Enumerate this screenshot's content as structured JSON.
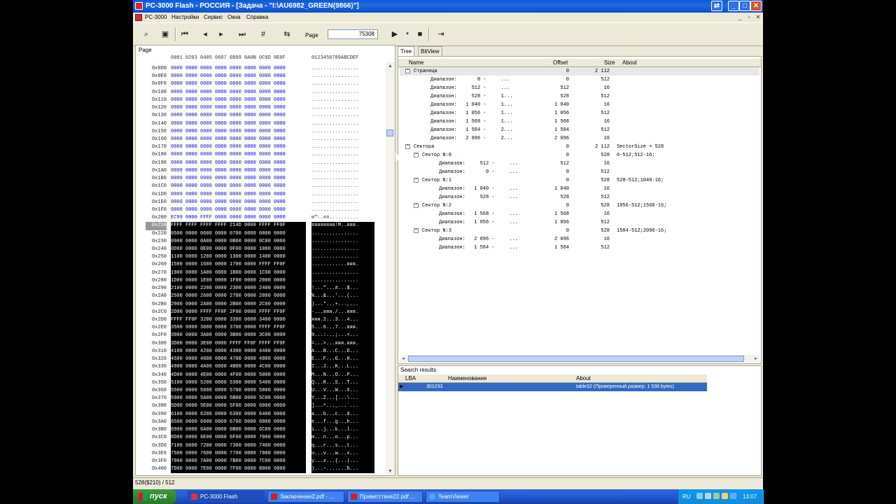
{
  "window": {
    "title": "PC-3000 Flash  - РОССИЯ - [Задача - \"I:\\AU6982_GREEN(9866)\"]"
  },
  "menu": {
    "app_label": "PC-3000",
    "items": [
      "Настройки",
      "Сервис",
      "Окна",
      "Справка"
    ]
  },
  "toolbar": {
    "page_label": "Page",
    "page_value": "75308"
  },
  "hex": {
    "page_label": "Page",
    "header_hex": "0001 0203 0405 0607 0809 0A0B 0C0D 0E0F",
    "header_ascii": "0123456789ABCDEF",
    "rows": [
      {
        "addr": "0x0D0",
        "hex": "0000 0000 0000 0000 0000 0000 0000 0000",
        "ascii": "................",
        "dark": false
      },
      {
        "addr": "0x0E0",
        "hex": "0000 0000 0000 0000 0000 0000 0000 0000",
        "ascii": "................",
        "dark": false
      },
      {
        "addr": "0x0F0",
        "hex": "0000 0000 0000 0000 0000 0000 0000 0000",
        "ascii": "................",
        "dark": false
      },
      {
        "addr": "0x100",
        "hex": "0000 0000 0000 0000 0000 0000 0000 0000",
        "ascii": "................",
        "dark": false
      },
      {
        "addr": "0x110",
        "hex": "0000 0000 0000 0000 0000 0000 0000 0000",
        "ascii": "................",
        "dark": false
      },
      {
        "addr": "0x120",
        "hex": "0000 0000 0000 0000 0000 0000 0000 0000",
        "ascii": "................",
        "dark": false
      },
      {
        "addr": "0x130",
        "hex": "0000 0000 0000 0000 0000 0000 0000 0000",
        "ascii": "................",
        "dark": false
      },
      {
        "addr": "0x140",
        "hex": "0000 0000 0000 0000 0000 0000 0000 0000",
        "ascii": "................",
        "dark": false
      },
      {
        "addr": "0x150",
        "hex": "0000 0000 0000 0000 0000 0000 0000 0000",
        "ascii": "................",
        "dark": false
      },
      {
        "addr": "0x160",
        "hex": "0000 0000 0000 0000 0000 0000 0000 0000",
        "ascii": "................",
        "dark": false
      },
      {
        "addr": "0x170",
        "hex": "0000 0000 0000 0000 0000 0000 0000 0000",
        "ascii": "................",
        "dark": false
      },
      {
        "addr": "0x180",
        "hex": "0000 0000 0000 0000 0000 0000 0000 0000",
        "ascii": "................",
        "dark": false
      },
      {
        "addr": "0x190",
        "hex": "0000 0000 0000 0000 0000 0000 0000 0000",
        "ascii": "................",
        "dark": false
      },
      {
        "addr": "0x1A0",
        "hex": "0000 0000 0000 0000 0000 0000 0000 0000",
        "ascii": "................",
        "dark": false
      },
      {
        "addr": "0x1B0",
        "hex": "0000 0000 0000 0000 0000 0000 0000 0000",
        "ascii": "................",
        "dark": false
      },
      {
        "addr": "0x1C0",
        "hex": "0000 0000 0000 0000 0000 0000 0000 0000",
        "ascii": "................",
        "dark": false
      },
      {
        "addr": "0x1D0",
        "hex": "0000 0000 0000 0000 0000 0000 0000 0000",
        "ascii": "................",
        "dark": false
      },
      {
        "addr": "0x1E0",
        "hex": "0000 0000 0000 0000 0000 0000 0000 0000",
        "ascii": "................",
        "dark": false
      },
      {
        "addr": "0x1F0",
        "hex": "0000 0000 0000 0000 0000 0000 0000 0000",
        "ascii": "................",
        "dark": false
      },
      {
        "addr": "0x200",
        "hex": "EC99 0000 FFFF 0000 0000 0000 0000 0000",
        "ascii": "м™..яя..........",
        "dark": false
      },
      {
        "addr": "0x210",
        "hex": "FFFF FFFF FFFF FFFF 214D 0000 FFFF FF0F",
        "ascii": "яяяяяяяя!M..яяя.",
        "dark": true,
        "cur": true
      },
      {
        "addr": "0x220",
        "hex": "0500 0000 0600 0000 0700 0000 0800 0000",
        "ascii": "................",
        "dark": true
      },
      {
        "addr": "0x230",
        "hex": "0900 0000 0A00 0000 0B00 0000 0C00 0000",
        "ascii": "................",
        "dark": true
      },
      {
        "addr": "0x240",
        "hex": "0D00 0000 0E00 0000 0F00 0000 1000 0000",
        "ascii": "................",
        "dark": true
      },
      {
        "addr": "0x250",
        "hex": "1100 0000 1200 0000 1300 0000 1400 0000",
        "ascii": "................",
        "dark": true
      },
      {
        "addr": "0x260",
        "hex": "1500 0000 1600 0000 1700 0000 FFFF FF0F",
        "ascii": "............яяя.",
        "dark": true
      },
      {
        "addr": "0x270",
        "hex": "1900 0000 1A00 0000 1B00 0000 1C00 0000",
        "ascii": "................",
        "dark": true
      },
      {
        "addr": "0x280",
        "hex": "1D00 0000 1E00 0000 1F00 0000 2000 0000",
        "ascii": "................",
        "dark": true
      },
      {
        "addr": "0x290",
        "hex": "2100 0000 2200 0000 2300 0000 2400 0000",
        "ascii": "!...\"...#...$...",
        "dark": true
      },
      {
        "addr": "0x2A0",
        "hex": "2500 0000 2600 0000 2700 0000 2800 0000",
        "ascii": "%...&...'...(...",
        "dark": true
      },
      {
        "addr": "0x2B0",
        "hex": "2900 0000 2A00 0000 2B00 0000 2C00 0000",
        "ascii": ")...*...+...,...",
        "dark": true
      },
      {
        "addr": "0x2C0",
        "hex": "2D00 0000 FFFF FF0F 2F00 0000 FFFF FF0F",
        "ascii": "-...яяя./...яяя.",
        "dark": true
      },
      {
        "addr": "0x2D0",
        "hex": "FFFF FF0F 3200 0000 3300 0000 3400 0000",
        "ascii": "яяя.2...3...4...",
        "dark": true
      },
      {
        "addr": "0x2E0",
        "hex": "3500 0000 3600 0000 3700 0000 FFFF FF0F",
        "ascii": "5...6...7...яяя.",
        "dark": true
      },
      {
        "addr": "0x2F0",
        "hex": "3900 0000 3A00 0000 3B00 0000 3C00 0000",
        "ascii": "9...:...;...<...",
        "dark": true
      },
      {
        "addr": "0x300",
        "hex": "3D00 0000 3E00 0000 FFFF FF0F FFFF FF0F",
        "ascii": "=...>...яяя.яяя.",
        "dark": true
      },
      {
        "addr": "0x310",
        "hex": "4100 0000 4200 0000 4300 0000 4400 0000",
        "ascii": "A...B...C...D...",
        "dark": true
      },
      {
        "addr": "0x320",
        "hex": "4500 0000 4600 0000 4700 0000 4800 0000",
        "ascii": "E...F...G...H...",
        "dark": true
      },
      {
        "addr": "0x330",
        "hex": "4900 0000 4A00 0000 4B00 0000 4C00 0000",
        "ascii": "I...J...K...L...",
        "dark": true
      },
      {
        "addr": "0x340",
        "hex": "4D00 0000 4E00 0000 4F00 0000 5000 0000",
        "ascii": "M...N...O...P...",
        "dark": true
      },
      {
        "addr": "0x350",
        "hex": "5100 0000 5200 0000 5300 0000 5400 0000",
        "ascii": "Q...R...S...T...",
        "dark": true
      },
      {
        "addr": "0x360",
        "hex": "5500 0000 5600 0000 5700 0000 5800 0000",
        "ascii": "U...V...W...X...",
        "dark": true
      },
      {
        "addr": "0x370",
        "hex": "5900 0000 5A00 0000 5B00 0000 5C00 0000",
        "ascii": "Y...Z...[...\\...",
        "dark": true
      },
      {
        "addr": "0x380",
        "hex": "5D00 0000 5E00 0000 5F00 0000 6000 0000",
        "ascii": "]...^..._...`...",
        "dark": true
      },
      {
        "addr": "0x390",
        "hex": "6100 0000 6200 0000 6300 0000 6400 0000",
        "ascii": "a...b...c...d...",
        "dark": true
      },
      {
        "addr": "0x3A0",
        "hex": "6500 0000 6600 0000 6700 0000 6800 0000",
        "ascii": "e...f...g...h...",
        "dark": true
      },
      {
        "addr": "0x3B0",
        "hex": "6900 0000 6A00 0000 6B00 0000 6C00 0000",
        "ascii": "i...j...k...l...",
        "dark": true
      },
      {
        "addr": "0x3C0",
        "hex": "6D00 0000 6E00 0000 6F00 0000 7000 0000",
        "ascii": "m...n...o...p...",
        "dark": true
      },
      {
        "addr": "0x3D0",
        "hex": "7100 0000 7200 0000 7300 0000 7400 0000",
        "ascii": "q...r...s...t...",
        "dark": true
      },
      {
        "addr": "0x3E0",
        "hex": "7500 0000 7600 0000 7700 0000 7800 0000",
        "ascii": "u...v...w...x...",
        "dark": true
      },
      {
        "addr": "0x3F0",
        "hex": "7900 0000 7A00 0000 7B00 0000 7C00 0000",
        "ascii": "y...z...{...|...",
        "dark": true
      },
      {
        "addr": "0x400",
        "hex": "7D00 0000 7E00 0000 7F00 0000 8000 0000",
        "ascii": "}...~.......Ђ...",
        "dark": true
      }
    ]
  },
  "tabs": [
    "Tree",
    "BitView"
  ],
  "tree": {
    "headers": {
      "name": "Name",
      "offset": "Offset",
      "size": "Size",
      "about": "About"
    },
    "rows": [
      {
        "level": 1,
        "exp": "−",
        "name": "Страница",
        "range": "",
        "off": "0",
        "size": "2 112",
        "about": ""
      },
      {
        "level": 2,
        "exp": "",
        "name": "Диапазон:",
        "range": "     0 -     ...",
        "off": "0",
        "size": "512",
        "about": ""
      },
      {
        "level": 2,
        "exp": "",
        "name": "Диапазон:",
        "range": "   512 -     ...",
        "off": "512",
        "size": "16",
        "about": ""
      },
      {
        "level": 2,
        "exp": "",
        "name": "Диапазон:",
        "range": "   528 -     1...",
        "off": "528",
        "size": "512",
        "about": ""
      },
      {
        "level": 2,
        "exp": "",
        "name": "Диапазон:",
        "range": " 1 040 -     1...",
        "off": "1 040",
        "size": "16",
        "about": ""
      },
      {
        "level": 2,
        "exp": "",
        "name": "Диапазон:",
        "range": " 1 056 -     1...",
        "off": "1 056",
        "size": "512",
        "about": ""
      },
      {
        "level": 2,
        "exp": "",
        "name": "Диапазон:",
        "range": " 1 568 -     1...",
        "off": "1 568",
        "size": "16",
        "about": ""
      },
      {
        "level": 2,
        "exp": "",
        "name": "Диапазон:",
        "range": " 1 584 -     2...",
        "off": "1 584",
        "size": "512",
        "about": ""
      },
      {
        "level": 2,
        "exp": "",
        "name": "Диапазон:",
        "range": " 2 096 -     2...",
        "off": "2 096",
        "size": "16",
        "about": ""
      },
      {
        "level": 1,
        "exp": "−",
        "name": "Сектора",
        "range": "",
        "off": "0",
        "size": "2 112",
        "about": "SectorSize = 528"
      },
      {
        "level": 2,
        "exp": "−",
        "name": "Сектор N:0",
        "range": "",
        "off": "0",
        "size": "528",
        "about": "0-512;512-16;"
      },
      {
        "level": 3,
        "exp": "",
        "name": "Диапазон:",
        "range": "   512 -     ...",
        "off": "512",
        "size": "16",
        "about": ""
      },
      {
        "level": 3,
        "exp": "",
        "name": "Диапазон:",
        "range": "     0 -     ...",
        "off": "0",
        "size": "512",
        "about": ""
      },
      {
        "level": 2,
        "exp": "−",
        "name": "Сектор N:1",
        "range": "",
        "off": "0",
        "size": "528",
        "about": "528-512;1040-16;"
      },
      {
        "level": 3,
        "exp": "",
        "name": "Диапазон:",
        "range": " 1 040 -     ...",
        "off": "1 040",
        "size": "16",
        "about": ""
      },
      {
        "level": 3,
        "exp": "",
        "name": "Диапазон:",
        "range": "   528 -     ...",
        "off": "528",
        "size": "512",
        "about": ""
      },
      {
        "level": 2,
        "exp": "−",
        "name": "Сектор N:2",
        "range": "",
        "off": "0",
        "size": "528",
        "about": "1056-512;1568-16;"
      },
      {
        "level": 3,
        "exp": "",
        "name": "Диапазон:",
        "range": " 1 568 -     ...",
        "off": "1 568",
        "size": "16",
        "about": ""
      },
      {
        "level": 3,
        "exp": "",
        "name": "Диапазон:",
        "range": " 1 056 -     ...",
        "off": "1 056",
        "size": "512",
        "about": ""
      },
      {
        "level": 2,
        "exp": "−",
        "name": "Сектор N:3",
        "range": "",
        "off": "0",
        "size": "528",
        "about": "1584-512;2096-16;"
      },
      {
        "level": 3,
        "exp": "",
        "name": "Диапазон:",
        "range": " 2 096 -     ...",
        "off": "2 096",
        "size": "16",
        "about": ""
      },
      {
        "level": 3,
        "exp": "",
        "name": "Диапазон:",
        "range": " 1 584 -     ...",
        "off": "1 584",
        "size": "512",
        "about": ""
      }
    ]
  },
  "search": {
    "label": "Search results",
    "headers": {
      "lba": "LBA",
      "name": "Наименование",
      "about": "About"
    },
    "rows": [
      {
        "lba": "301233",
        "name": "",
        "about": "table32 (Проверенный размер: 1 536 bytes)"
      }
    ]
  },
  "status": {
    "text": "528($210) / 512"
  },
  "taskbar": {
    "start": "пуск",
    "tasks": [
      "PC-3000 Flash",
      "Заключение2.pdf - ...",
      "Приветствие22.pdf ...",
      "TeamViewer"
    ],
    "lang": "RU",
    "clock": "13:07"
  },
  "colors": {
    "title_blue": "#0a5bd6",
    "hex_blue": "#0000ff",
    "select_blue": "#316ac5",
    "taskbar_blue": "#245edb",
    "start_green": "#2f8c2f"
  }
}
